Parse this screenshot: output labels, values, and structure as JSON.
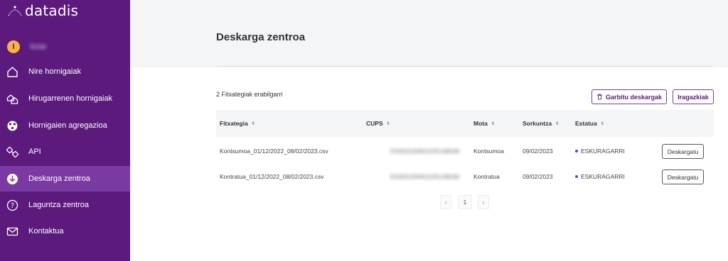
{
  "app": {
    "logo_text": "datadis"
  },
  "user": {
    "initial": "I",
    "name": "Itziar"
  },
  "nav": {
    "items": [
      {
        "label": "Nire hornigaiak"
      },
      {
        "label": "Hirugarrenen hornigaiak"
      },
      {
        "label": "Hornigaien agregazioa"
      },
      {
        "label": "API"
      },
      {
        "label": "Deskarga zentroa"
      },
      {
        "label": "Laguntza zentroa"
      },
      {
        "label": "Kontaktua"
      }
    ]
  },
  "main": {
    "title": "Deskarga zentroa",
    "files_count": "2 Fitxategiak erabilgarri",
    "clear_button": "Garbitu deskargak",
    "filter_button": "Iragazkiak"
  },
  "table": {
    "columns": [
      "Fitxategia",
      "CUPS",
      "Mota",
      "Sorkuntza",
      "Estatua"
    ],
    "sort_glyph": "⇕",
    "download_label": "Deskargatu",
    "rows": [
      {
        "file": "Kontsumoa_01/12/2022_08/02/2023.csv",
        "cups": "ES0021000011051ABGM",
        "type": "Kontsumoa",
        "created": "09/02/2023",
        "status": "ESKURAGARRI"
      },
      {
        "file": "Kontratua_01/12/2022_08/02/2023.csv",
        "cups": "ES0021000011051ABGM",
        "type": "Kontratua",
        "created": "09/02/2023",
        "status": "ESKURAGARRI"
      }
    ]
  },
  "pagination": {
    "prev": "‹",
    "page": "1",
    "next": "›"
  },
  "colors": {
    "sidebar": "#5b1a7c",
    "active": "#7b3aa3",
    "badge": "#f4b63e"
  }
}
